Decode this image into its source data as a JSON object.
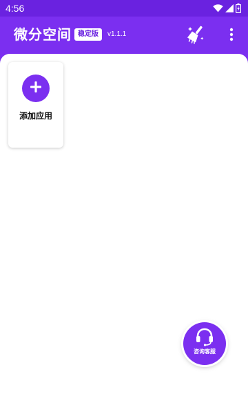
{
  "status_bar": {
    "time": "4:56",
    "icons": [
      "wifi-icon",
      "cell-signal-icon",
      "battery-icon"
    ]
  },
  "app_bar": {
    "title": "微分空间",
    "edition_badge": "稳定版",
    "version": "v1.1.1",
    "actions": [
      "broom-clean-icon",
      "more-vertical-icon"
    ]
  },
  "content": {
    "add_app_label": "添加应用",
    "add_icon": "plus-icon"
  },
  "support_fab": {
    "label": "咨询客服",
    "icon": "headset-icon"
  },
  "colors": {
    "primary": "#7b2ff0",
    "status_bar": "#6a22e0",
    "background": "#ffffff"
  }
}
